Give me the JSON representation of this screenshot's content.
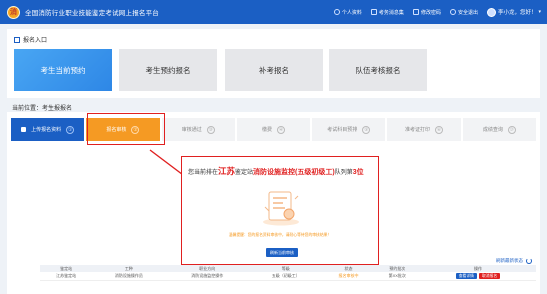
{
  "header": {
    "site_title": "全国消防行业职业技能鉴定考试网上报名平台",
    "nav": [
      {
        "label": "个人资料",
        "icon": "user-icon"
      },
      {
        "label": "考务消息集",
        "icon": "message-icon"
      },
      {
        "label": "修改密码",
        "icon": "lock-icon"
      },
      {
        "label": "安全退出",
        "icon": "power-icon"
      }
    ],
    "user_name": "李小龙，您好！",
    "logo_text": "消"
  },
  "entry": {
    "title": "报名入口",
    "tiles": [
      "考生当前预约",
      "考生预约报名",
      "补考报名",
      "队伍考核报名"
    ]
  },
  "location": "当前位置：考生报报名",
  "steps": [
    {
      "label": "上传报名资料",
      "num": "①"
    },
    {
      "label": "报名审核",
      "num": "②"
    },
    {
      "label": "审核通过",
      "num": "③"
    },
    {
      "label": "缴费",
      "num": "④"
    },
    {
      "label": "考试科目预排",
      "num": "⑤"
    },
    {
      "label": "准考证打印",
      "num": "⑥"
    },
    {
      "label": "成绩查询",
      "num": "⑦"
    }
  ],
  "popup": {
    "msg_prefix": "您当前排在",
    "province": "江苏",
    "msg_mid": "鉴定站",
    "occupation": "消防设施监控(五级初级工)",
    "msg_suffix": "队列第",
    "position": "3位",
    "tip": "温馨提醒：您的报名资料审核中，请耐心等待您的审核结果！",
    "button": "刷新当前审核"
  },
  "refresh_label": "刷新最新状态",
  "table": {
    "headers": [
      "鉴定站",
      "工种",
      "职业方向",
      "等级",
      "状态",
      "预约批次",
      "操作"
    ],
    "rows": [
      [
        "江苏鉴定站",
        "消防设施操作员",
        "消防设施监控操作",
        "五级（初级工）",
        "报名审核中",
        "第XX批次"
      ]
    ],
    "actions": [
      "查看详情",
      "取消报名"
    ]
  },
  "colors": {
    "primary": "#1b5fc4",
    "accent_orange": "#f59a23",
    "highlight_red": "#e02020"
  }
}
